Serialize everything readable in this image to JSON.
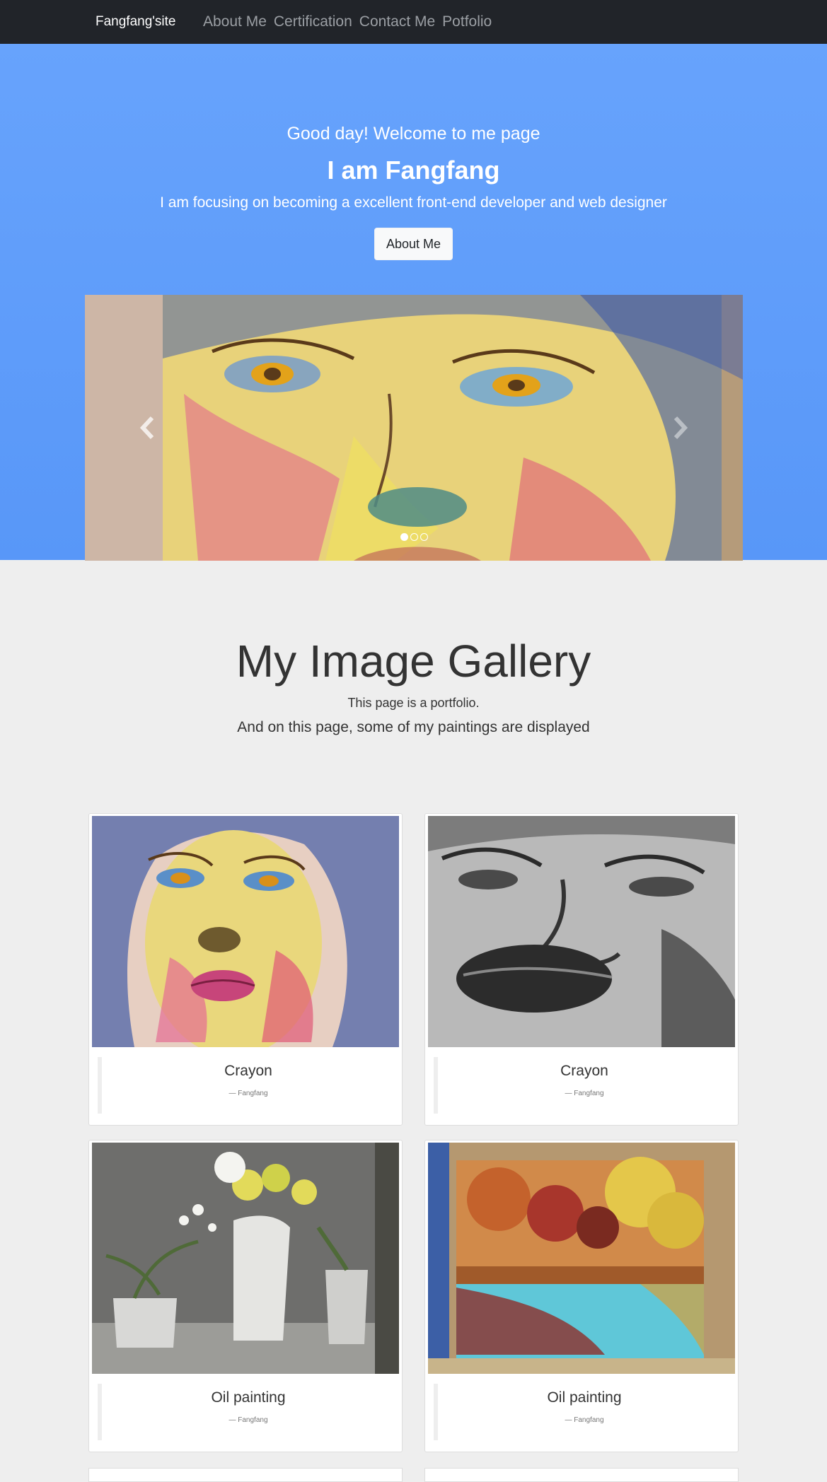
{
  "navbar": {
    "brand": "Fangfang'site",
    "links": [
      "About Me",
      "Certification",
      "Contact Me",
      "Potfolio"
    ]
  },
  "hero": {
    "greeting": "Good day! Welcome to me page",
    "title": "I am Fangfang",
    "subtitle": "I am focusing on becoming a excellent front-end developer and web designer",
    "button_label": "About Me"
  },
  "carousel": {
    "slide_count": 3,
    "active_index": 0,
    "prev_icon": "chevron-left-icon",
    "next_icon": "chevron-right-icon"
  },
  "gallery": {
    "title": "My Image Gallery",
    "desc1": "This page is a portfolio.",
    "desc2": "And on this page, some of my paintings are displayed",
    "cards": [
      {
        "title": "Crayon",
        "author": "— Fangfang"
      },
      {
        "title": "Crayon",
        "author": "— Fangfang"
      },
      {
        "title": "Oil painting",
        "author": "— Fangfang"
      },
      {
        "title": "Oil painting",
        "author": "— Fangfang"
      }
    ]
  },
  "colors": {
    "navbar": "#212429",
    "hero": "#62a0fb",
    "page_background": "#eeeeee"
  }
}
